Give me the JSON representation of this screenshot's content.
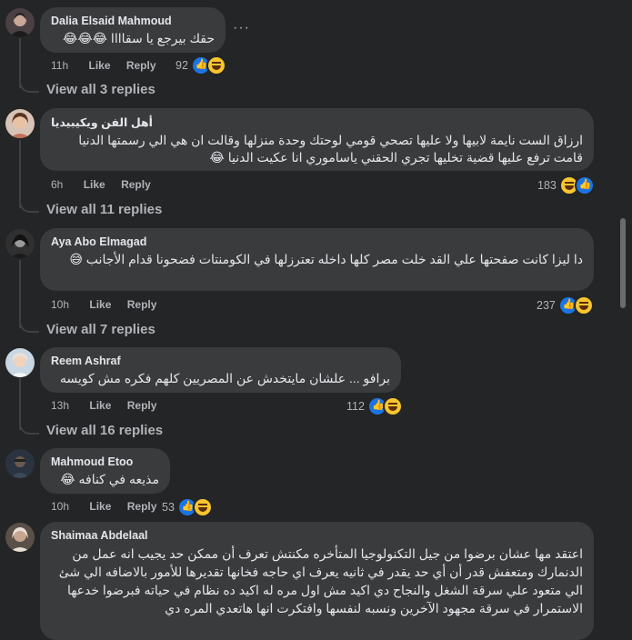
{
  "comments": [
    {
      "author": "Dalia Elsaid Mahmoud",
      "text": "حقك بيرجع يا سقاااا 😂😂😂",
      "time": "11h",
      "like": "Like",
      "reply": "Reply",
      "reaction_count": "92",
      "view_replies": "View all 3 replies",
      "more": "···"
    },
    {
      "author": "أهل الفن ويكيبيديا",
      "text": "ارزاق الست نايمة لابيها ولا عليها تصحي قومي لوحتك وحدة منزلها وقالت ان هي الي رسمتها الدنيا قامت ترفع عليها قضية تخليها تجري الحقني ياساموري انا عكيت الدنيا 😂",
      "time": "6h",
      "like": "Like",
      "reply": "Reply",
      "reaction_count": "183",
      "view_replies": "View all 11 replies"
    },
    {
      "author": "Aya Abo Elmagad",
      "text": "دا ليزا كانت صفحتها علي القد خلت مصر كلها داخله تعترزلها في الكومنتات فضحونا قدام الأجانب 😅",
      "time": "10h",
      "like": "Like",
      "reply": "Reply",
      "reaction_count": "237",
      "view_replies": "View all 7 replies"
    },
    {
      "author": "Reem Ashraf",
      "text": "برافو ... علشان مايتخدش عن المصريين كلهم فكره مش كويسه",
      "time": "13h",
      "like": "Like",
      "reply": "Reply",
      "reaction_count": "112",
      "view_replies": "View all 16 replies"
    },
    {
      "author": "Mahmoud Etoo",
      "text": "مذيعه في كنافه 😂",
      "time": "10h",
      "like": "Like",
      "reply": "Reply",
      "reaction_count": "53"
    },
    {
      "author": "Shaimaa Abdelaal",
      "text": "اعتقد مها عشان برضوا من جيل التكنولوجيا المتأخره مكنتش تعرف أن ممكن حد يجيب انه عمل من الدنمارك ومتعفش قدر أن أي حد يقدر في ثانيه يعرف اي حاجه فخانها تقديرها للأمور بالاضافه الي شئ الي متعود علي سرقة الشغل والنجاح دي اكيد مش اول مره له اكيد ده نظام في حياته فبرضوا خدعها الاستمرار في سرقة مجهود الآخرين ونسبه لنفسها وافتكرت انها هاتعدي المره دي"
    }
  ],
  "colors": {
    "background": "#242526",
    "bubble": "#3a3b3c",
    "like_blue": "#1b74e4",
    "haha_yellow": "#f7c52f",
    "muted_text": "#b0b3b8"
  }
}
